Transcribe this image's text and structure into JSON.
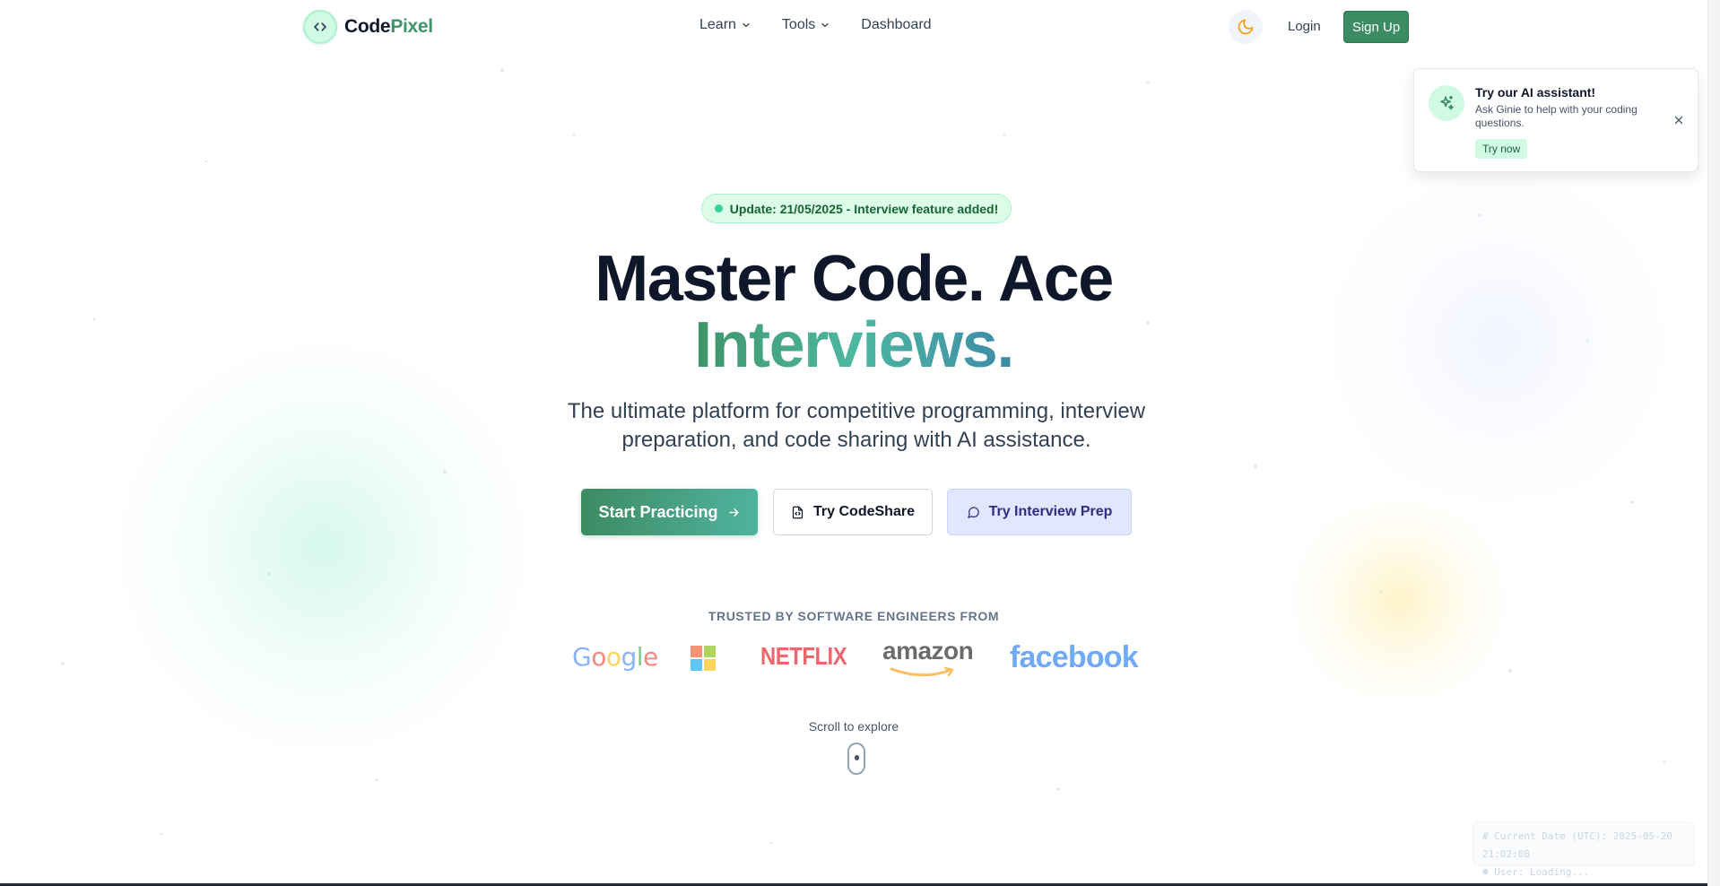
{
  "brand": {
    "name_part1": "Code",
    "name_part2": "Pixel",
    "logo_icon": "code-brackets-icon"
  },
  "nav": {
    "links": [
      {
        "label": "Learn",
        "has_dropdown": true
      },
      {
        "label": "Tools",
        "has_dropdown": true
      },
      {
        "label": "Dashboard",
        "has_dropdown": false
      }
    ],
    "theme_icon": "moon-icon",
    "login_label": "Login",
    "signup_label": "Sign Up"
  },
  "toast": {
    "icon": "sparkles-icon",
    "title": "Try our AI assistant!",
    "body": "Ask Ginie to help with your coding questions.",
    "cta_label": "Try now",
    "close_icon": "close-icon"
  },
  "hero": {
    "badge_text": "Update: 21/05/2025 - Interview feature added!",
    "headline_line1": "Master Code. Ace",
    "headline_line2": "Interviews.",
    "subtitle": "The ultimate platform for competitive programming, interview preparation, and code sharing with AI assistance.",
    "buttons": {
      "primary_label": "Start Practicing",
      "secondary_label": "Try CodeShare",
      "tertiary_label": "Try Interview Prep"
    }
  },
  "trusted": {
    "label": "TRUSTED BY SOFTWARE ENGINEERS FROM",
    "logos": [
      "Google",
      "Microsoft",
      "NETFLIX",
      "amazon",
      "facebook"
    ]
  },
  "scroll_hint": "Scroll to explore",
  "debug": {
    "date_line": "Current Date (UTC): 2025-05-20 21:02:08",
    "user_line": "User: Loading..."
  },
  "colors": {
    "brand_green": "#3d8b63",
    "accent_teal": "#4db8a0",
    "indigo_bg": "#e0e7ff",
    "badge_bg": "#dcfce7"
  }
}
